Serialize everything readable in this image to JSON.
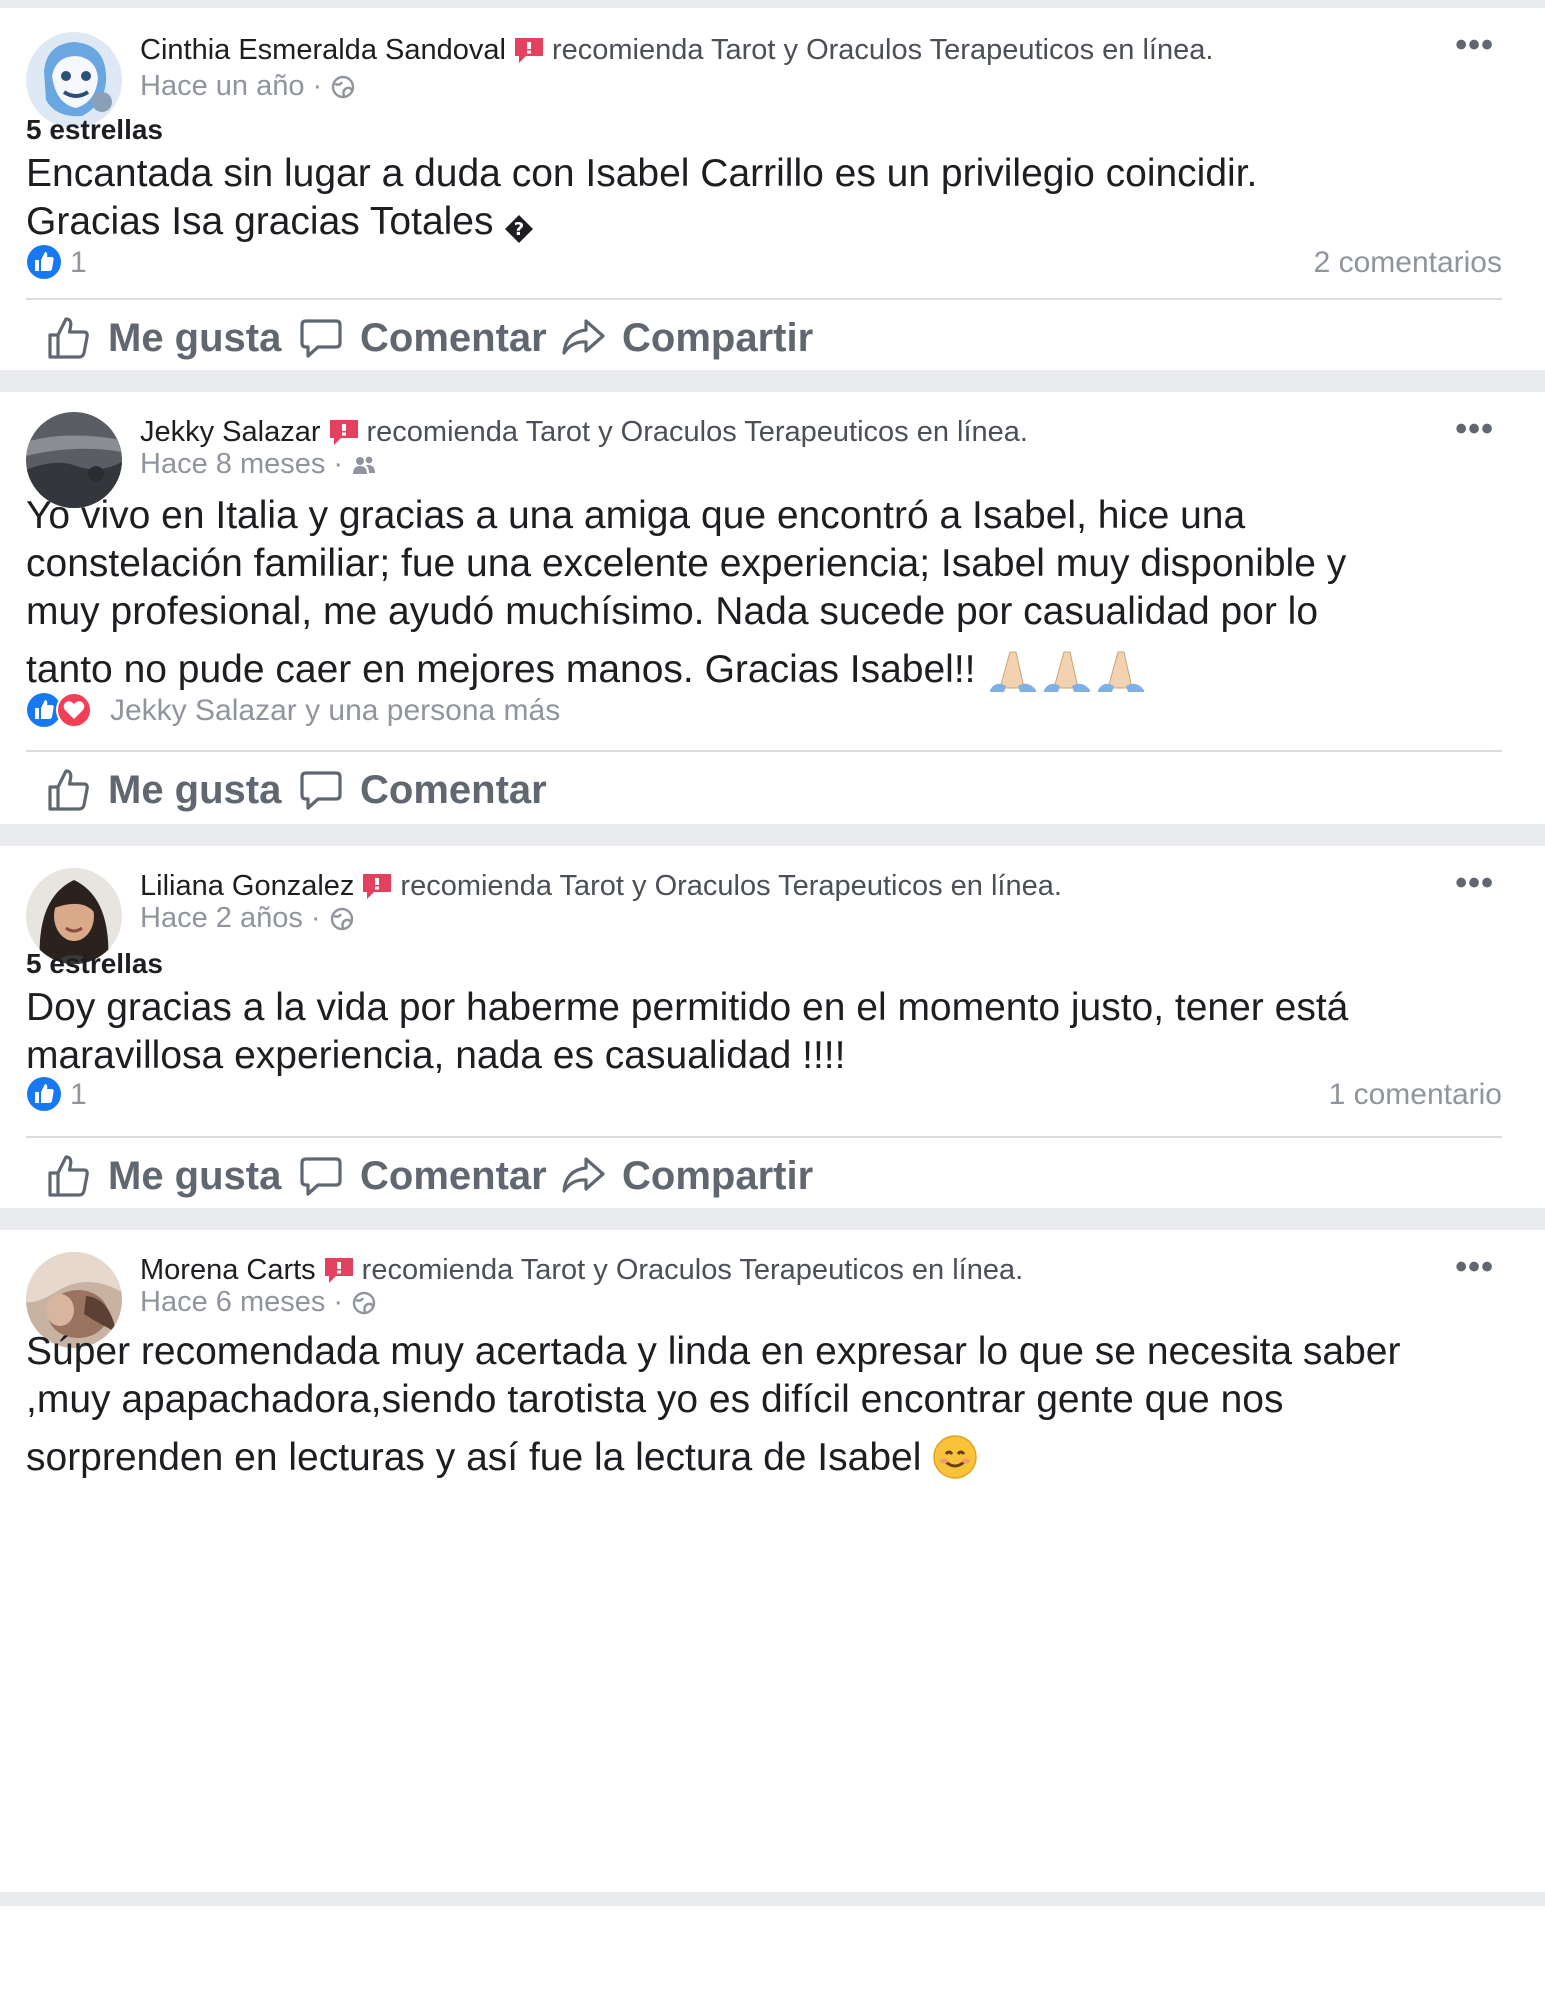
{
  "posts": [
    {
      "author": "Cinthia Esmeralda Sandoval",
      "recommendation": "recomienda Tarot y Oraculos Terapeuticos en línea.",
      "time": "Hace un año ·",
      "audience_icon": "globe-icon",
      "stars": "5 estrellas",
      "text_lines": [
        "Encantada sin lugar a duda con Isabel Carrillo es un privilegio coincidir.",
        "Gracias Isa gracias Totales"
      ],
      "trailing_glyph": "�",
      "reaction_icons": [
        "like-icon"
      ],
      "reaction_count": "1",
      "comments": "2 comentarios",
      "actions": [
        "Me gusta",
        "Comentar",
        "Compartir"
      ]
    },
    {
      "author": "Jekky Salazar",
      "recommendation": "recomienda Tarot y Oraculos Terapeuticos en línea.",
      "time": "Hace 8 meses ·",
      "audience_icon": "friends-icon",
      "text_lines": [
        "Yo vivo en Italia y gracias a una amiga que encontró a Isabel, hice una",
        "constelación familiar; fue una excelente experiencia; Isabel muy disponible y",
        "muy profesional, me ayudó muchísimo.  Nada sucede por casualidad por lo",
        "tanto no pude caer en mejores manos.  Gracias Isabel!!"
      ],
      "trailing_emoji": "praying-hands-icon",
      "reaction_icons": [
        "like-icon",
        "love-icon"
      ],
      "reaction_names": "Jekky Salazar y una persona más",
      "actions": [
        "Me gusta",
        "Comentar"
      ]
    },
    {
      "author": "Liliana Gonzalez",
      "recommendation": "recomienda Tarot y Oraculos Terapeuticos en línea.",
      "time": "Hace 2 años ·",
      "audience_icon": "globe-icon",
      "stars": "5 estrellas",
      "text_lines": [
        "Doy gracias a la vida por haberme permitido en el momento justo, tener está",
        "maravillosa experiencia, nada es casualidad !!!!"
      ],
      "reaction_icons": [
        "like-icon"
      ],
      "reaction_count": "1",
      "comments": "1 comentario",
      "actions": [
        "Me gusta",
        "Comentar",
        "Compartir"
      ]
    },
    {
      "author": "Morena Carts",
      "recommendation": "recomienda Tarot y Oraculos Terapeuticos en línea.",
      "time": "Hace 6 meses ·",
      "audience_icon": "globe-icon",
      "text_lines": [
        "Súper recomendada muy acertada y linda en expresar lo que se necesita saber",
        ",muy apapachadora,siendo tarotista yo es difícil encontrar gente que nos",
        "sorprenden en lecturas y así fue la lectura de Isabel"
      ],
      "trailing_emoji": "smiling-face-icon"
    }
  ],
  "colors": {
    "background": "#e9ebee",
    "card": "#ffffff",
    "primary_text": "#1c1e21",
    "secondary_text": "#90949c",
    "header_text": "#4b4f56",
    "action_text": "#606770",
    "like_blue": "#1877f2",
    "love_red": "#f33e58",
    "recommend_red": "#e4405f"
  }
}
